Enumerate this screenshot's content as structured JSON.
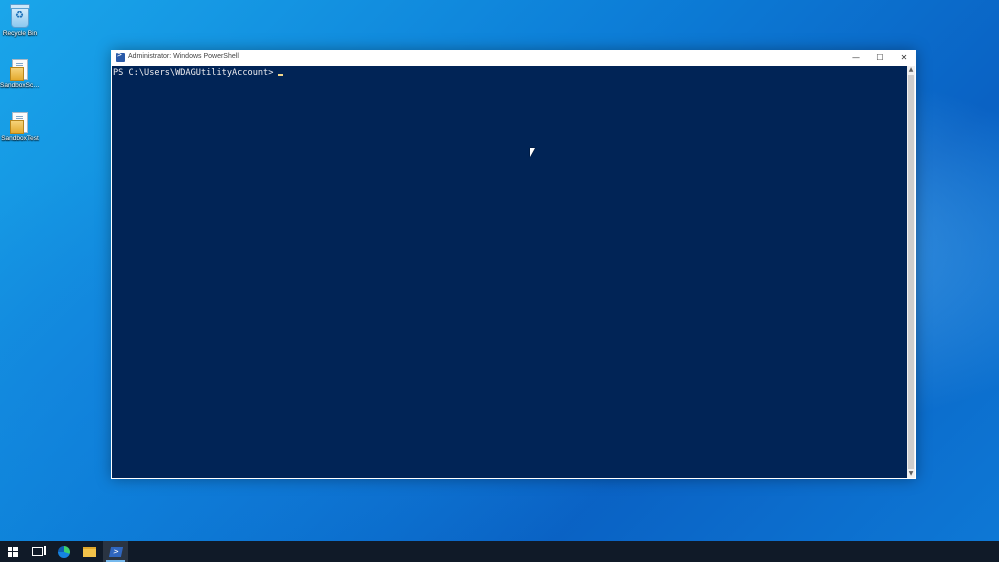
{
  "desktop": {
    "icons": [
      {
        "label": "Recycle Bin",
        "icon": "recycle-bin-icon"
      },
      {
        "label": "SandboxScr...",
        "icon": "file-icon"
      },
      {
        "label": "SandboxTest",
        "icon": "file-icon"
      }
    ]
  },
  "window": {
    "title": "Administrator: Windows PowerShell",
    "controls": {
      "minimize": "—",
      "maximize": "☐",
      "close": "✕"
    },
    "console": {
      "prompt": "PS C:\\Users\\WDAGUtilityAccount>"
    },
    "scrollbar": {
      "up": "▲",
      "down": "▼"
    }
  },
  "taskbar": {
    "items": [
      "start-button",
      "task-view",
      "microsoft-edge",
      "file-explorer",
      "windows-powershell"
    ]
  },
  "colors": {
    "console_bg": "#012456",
    "taskbar_bg": "#101a28",
    "accent": "#76b9ed"
  }
}
